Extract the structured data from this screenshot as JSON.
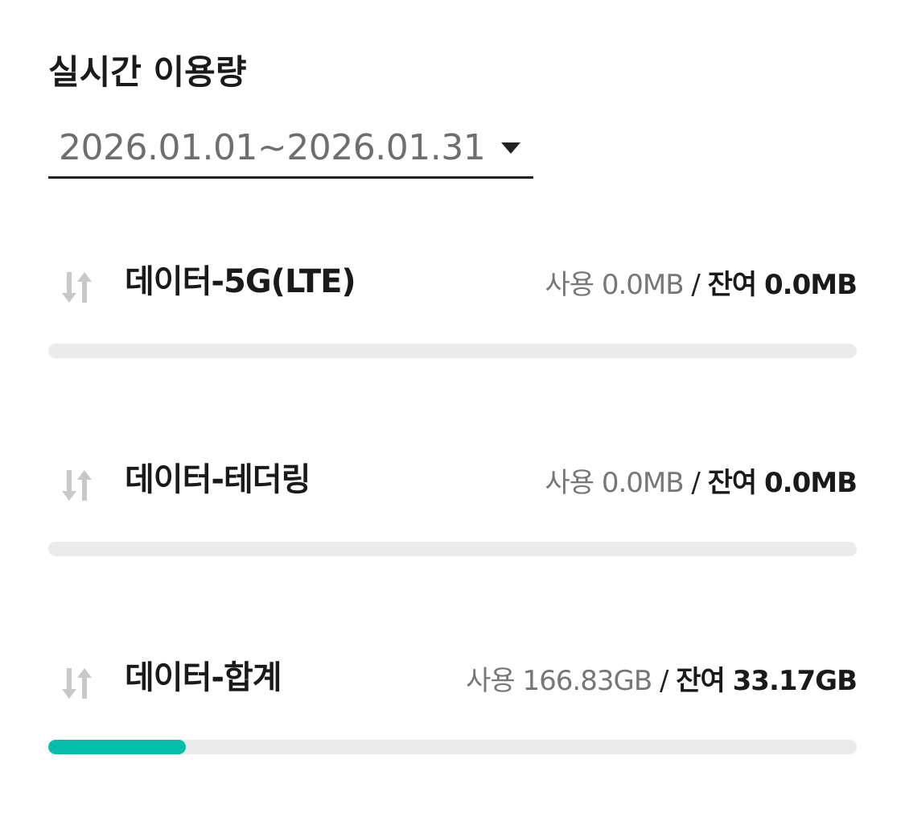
{
  "page": {
    "title": "실시간 이용량"
  },
  "period": {
    "value": "2026.01.01~2026.01.31"
  },
  "colors": {
    "bar_fill": "#06bfaa",
    "bar_track": "#ebebeb",
    "icon": "#c8c8c8"
  },
  "items": [
    {
      "name": "데이터-5G(LTE)",
      "used_label": "사용",
      "used_value": "0.0MB",
      "separator": "/",
      "remain_label": "잔여",
      "remain_value": "0.0MB",
      "progress": 0
    },
    {
      "name": "데이터-테더링",
      "used_label": "사용",
      "used_value": "0.0MB",
      "separator": "/",
      "remain_label": "잔여",
      "remain_value": "0.0MB",
      "progress": 0
    },
    {
      "name": "데이터-합계",
      "used_label": "사용",
      "used_value": "166.83GB",
      "separator": "/",
      "remain_label": "잔여",
      "remain_value": "33.17GB",
      "progress": 0.17
    }
  ],
  "icons": {
    "item_icon": "up-down-arrows-icon",
    "select_icon": "caret-down-icon"
  }
}
